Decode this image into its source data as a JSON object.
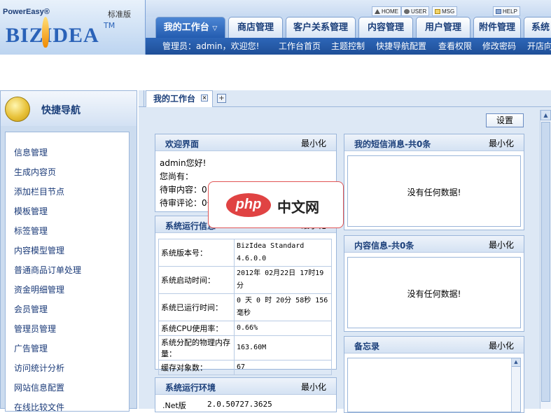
{
  "brand": {
    "small": "PowerEasy®",
    "edition": "标准版",
    "logo": "BIZIDEA",
    "tm": "TM"
  },
  "toplinks": [
    "HOME",
    "USER",
    "MSG",
    "HELP"
  ],
  "tabs": [
    "我的工作台",
    "商店管理",
    "客户关系管理",
    "内容管理",
    "用户管理",
    "附件管理",
    "系统"
  ],
  "subnav": {
    "greeting": "管理员：admin，欢迎您!",
    "links": [
      "工作台首页",
      "主题控制",
      "快捷导航配置",
      "查看权限",
      "修改密码",
      "开店向"
    ]
  },
  "sidebar": {
    "title": "快捷导航",
    "items": [
      "信息管理",
      "生成内容页",
      "添加栏目节点",
      "模板管理",
      "标签管理",
      "内容模型管理",
      "普通商品订单处理",
      "资金明细管理",
      "会员管理",
      "管理员管理",
      "广告管理",
      "访问统计分析",
      "网站信息配置",
      "在线比较文件"
    ]
  },
  "main": {
    "tab_label": "我的工作台",
    "tab_close": "×",
    "tab_add": "+",
    "settings_label": "设置",
    "minimize_label": "最小化",
    "welcome": {
      "title": "欢迎界面",
      "line1": "admin您好!",
      "line2": "您尚有：",
      "line3": "待审内容：0",
      "line4": "待审评论：0条"
    },
    "sysinfo": {
      "title": "系统运行信息",
      "rows": [
        {
          "k": "系统版本号：",
          "v": "BizIdea Standard 4.6.0.0"
        },
        {
          "k": "系统启动时间：",
          "v": "2012年 02月22日 17时19分"
        },
        {
          "k": "系统已运行时间：",
          "v": "0 天 0 时 20分 58秒 156毫秒"
        },
        {
          "k": "系统CPU使用率：",
          "v": "0.66%"
        },
        {
          "k": "系统分配的物理内存量：",
          "v": "163.60M"
        },
        {
          "k": "缓存对象数：",
          "v": "67"
        }
      ]
    },
    "env": {
      "title": "系统运行环境",
      "first_row_label": ".Net版",
      "first_row_value": "2.0.50727.3625"
    },
    "sms": {
      "title": "我的短信消息-共0条",
      "empty": "没有任何数据!"
    },
    "content": {
      "title": "内容信息-共0条",
      "empty": "没有任何数据!"
    },
    "memo": {
      "title": "备忘录"
    }
  },
  "watermark": {
    "badge": "php",
    "text": "中文网"
  },
  "colors": {
    "header_blue": "#2a5ea8",
    "panel_border": "#9bb6da",
    "link_blue": "#1a3a78",
    "watermark_red": "#e04343"
  }
}
